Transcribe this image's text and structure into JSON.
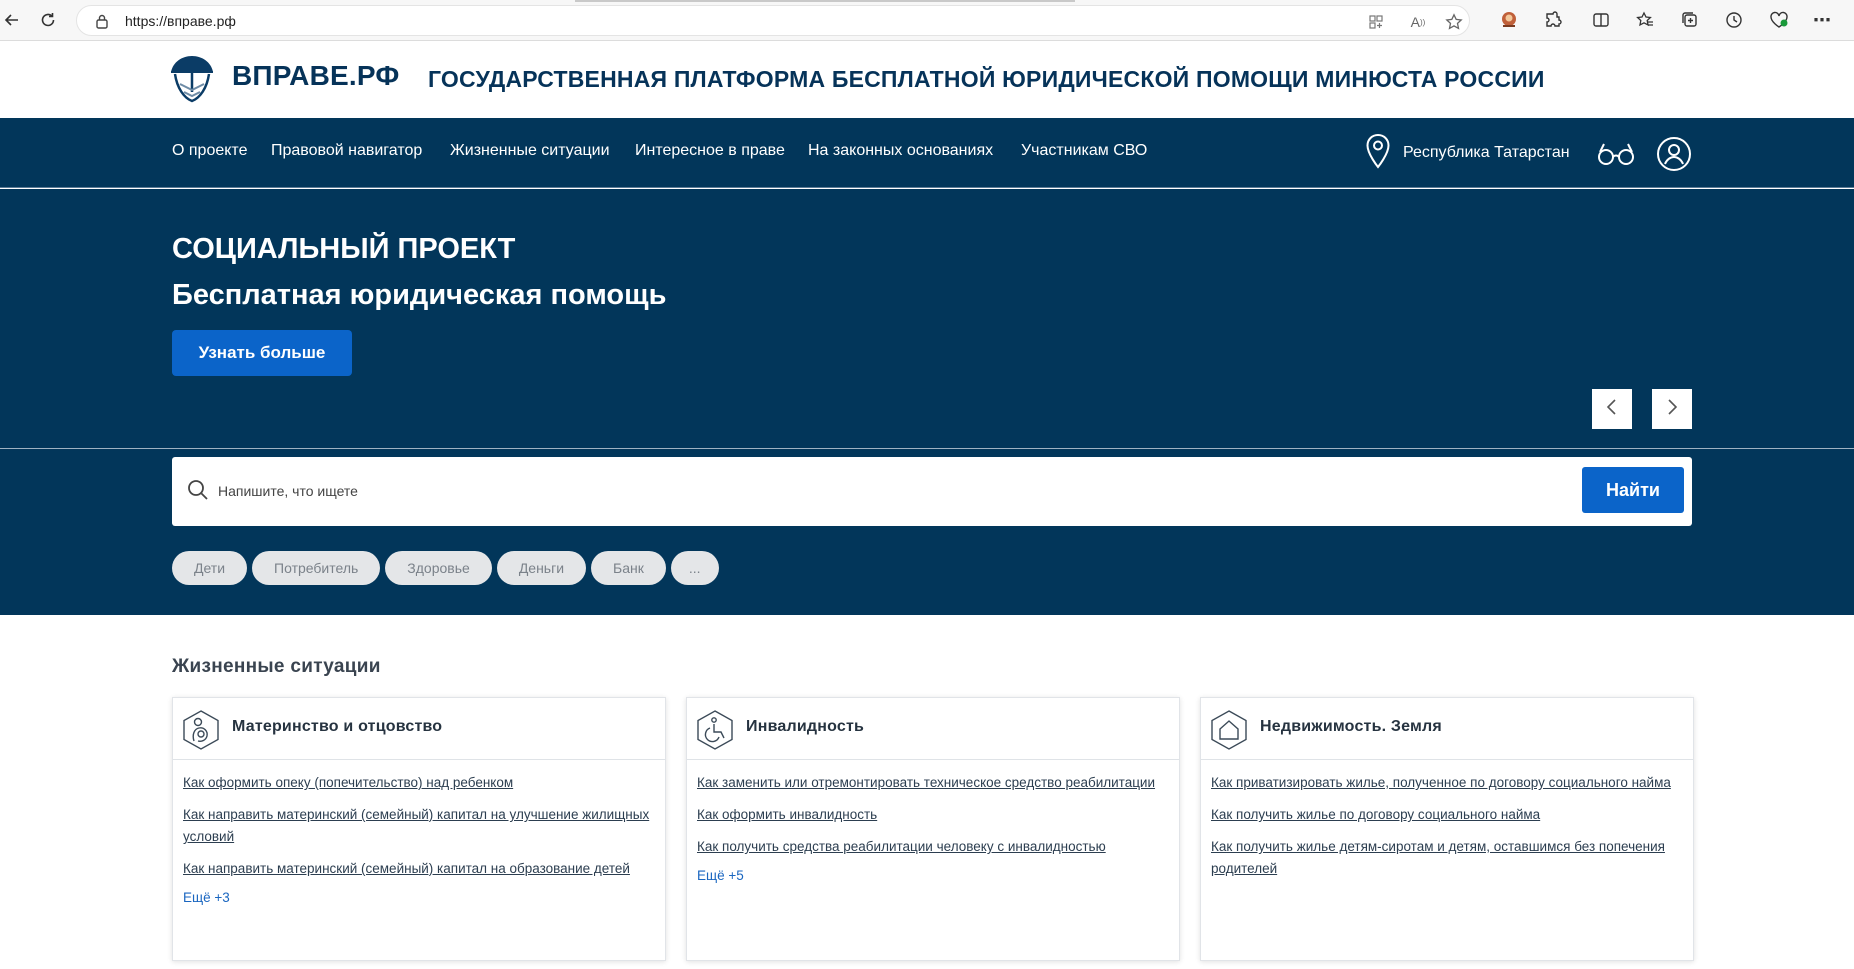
{
  "browser": {
    "url": "https://вправе.рф",
    "icons": [
      "back-icon",
      "reload-icon",
      "lock-icon",
      "apps-icon",
      "read-aloud-icon",
      "favorite-star-icon",
      "profile-icon",
      "extensions-icon",
      "split-screen-icon",
      "favorites-icon",
      "collections-icon",
      "history-icon",
      "health-icon",
      "more-icon"
    ]
  },
  "header": {
    "logo_text": "ВПРАВЕ.РФ",
    "title": "ГОСУДАРСТВЕННАЯ ПЛАТФОРМА БЕСПЛАТНОЙ ЮРИДИЧЕСКОЙ ПОМОЩИ МИНЮСТА РОССИИ"
  },
  "nav": {
    "items": [
      {
        "label": "О проекте"
      },
      {
        "label": "Правовой навигатор"
      },
      {
        "label": "Жизненные ситуации"
      },
      {
        "label": "Интересное в праве"
      },
      {
        "label": "На законных основаниях"
      },
      {
        "label": "Участникам СВО"
      }
    ],
    "region": "Республика Татарстан",
    "icons": [
      "location-pin-icon",
      "accessibility-glasses-icon",
      "user-account-icon"
    ]
  },
  "hero": {
    "kicker": "СОЦИАЛЬНЫЙ ПРОЕКТ",
    "title": "Бесплатная юридическая помощь",
    "button": "Узнать больше"
  },
  "search": {
    "placeholder": "Напишите, что ищете",
    "button": "Найти",
    "chips": [
      "Дети",
      "Потребитель",
      "Здоровье",
      "Деньги",
      "Банк",
      "..."
    ]
  },
  "life_situations": {
    "title": "Жизненные ситуации",
    "cards": [
      {
        "title": "Материнство и отцовство",
        "icon": "mother-child-icon",
        "links": [
          "Как оформить опеку (попечительство) над ребенком",
          "Как направить материнский (семейный) капитал на улучшение жилищных условий",
          "Как направить материнский (семейный) капитал на образование детей"
        ],
        "more": "Ещё +3"
      },
      {
        "title": "Инвалидность",
        "icon": "wheelchair-icon",
        "links": [
          "Как заменить или отремонтировать техническое средство реабилитации",
          "Как оформить инвалидность",
          "Как получить средства реабилитации человеку с инвалидностью"
        ],
        "more": "Ещё +5"
      },
      {
        "title": "Недвижимость. Земля",
        "icon": "house-icon",
        "links": [
          "Как приватизировать жилье, полученное по договору социального найма",
          "Как получить жилье по договору социального найма",
          "Как получить жилье детям-сиротам и детям, оставшимся без попечения родителей"
        ],
        "more": ""
      }
    ]
  },
  "colors": {
    "navy": "#02365a",
    "brand_blue": "#0b64c9",
    "logo_text": "#063359"
  }
}
